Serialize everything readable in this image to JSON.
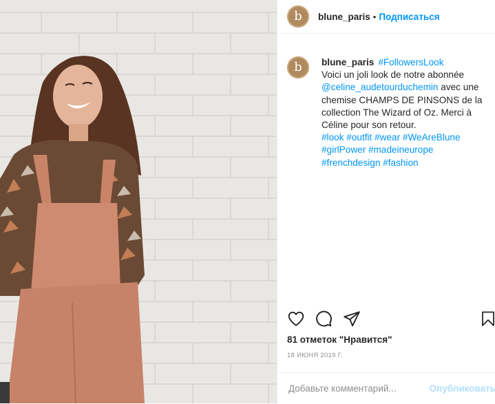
{
  "post": {
    "username": "blune_paris",
    "separator": "•",
    "follow_label": "Подписаться",
    "avatar_letter": "b"
  },
  "caption": {
    "username": "blune_paris",
    "hashtag_top": "#FollowersLook",
    "line1": "Voici un joli look de notre abonnée",
    "mention": "@celine_audetourduchemin",
    "line2": "avec une chemise CHAMPS DE PINSONS de la collection The Wizard of Oz. Merci à Céline pour son retour.",
    "tags": [
      "#look",
      "#outfit",
      "#wear",
      "#WeAreBlune",
      "#girlPower",
      "#madeineurope",
      "#frenchdesign",
      "#fashion"
    ]
  },
  "actions": {
    "like_icon": "heart-icon",
    "comment_icon": "comment-bubble-icon",
    "share_icon": "paper-plane-icon",
    "save_icon": "bookmark-icon"
  },
  "likes_text": "81 отметок \"Нравится\"",
  "date_text": "18 ИЮНЯ 2019 Г.",
  "comment_input": {
    "placeholder": "Добавьте комментарий...",
    "post_label": "Опубликовать"
  },
  "colors": {
    "link": "#0095f6",
    "post_disabled": "#b2dffc",
    "brand_avatar": "#b08b5e"
  }
}
